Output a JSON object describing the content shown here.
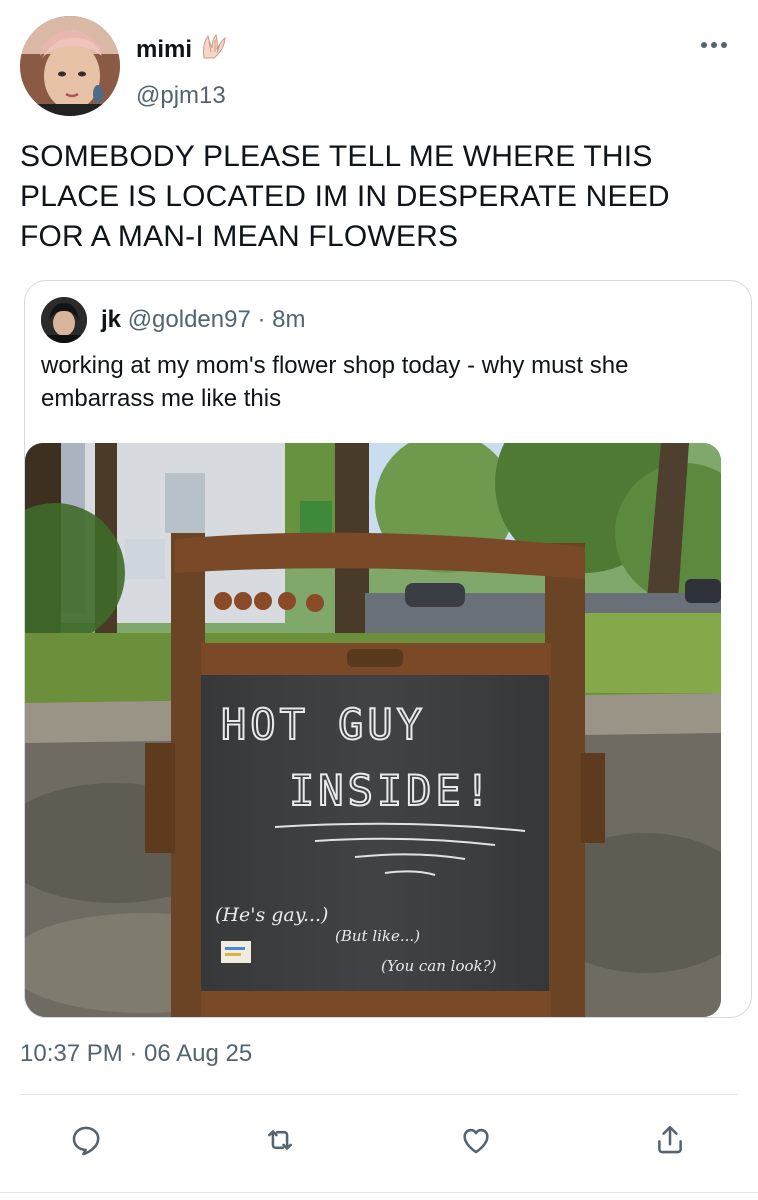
{
  "tweet": {
    "author": {
      "display_name": "mimi",
      "badge_emoji": "🪽",
      "handle": "@pjm13"
    },
    "text": "SOMEBODY PLEASE TELL ME WHERE THIS PLACE IS LOCATED IM IN DESPERATE NEED FOR A MAN-I MEAN FLOWERS",
    "timestamp": "10:37 PM · 06 Aug 25",
    "quote": {
      "display_name": "jk",
      "handle": "@golden97",
      "separator": "·",
      "time": "8m",
      "text": "working at my mom's flower shop today - why must she embarrass me like this",
      "image": {
        "sign_line1": "HOT GUY",
        "sign_line2": "INSIDE!",
        "note1": "(He's gay...)",
        "note2": "(But like...)",
        "note3": "(You can look?)"
      }
    }
  },
  "actions": {
    "reply_icon": "reply-icon",
    "retweet_icon": "retweet-icon",
    "like_icon": "heart-icon",
    "share_icon": "share-icon"
  },
  "colors": {
    "text_primary": "#0f1419",
    "text_secondary": "#536471",
    "border": "#d4d9dd"
  }
}
